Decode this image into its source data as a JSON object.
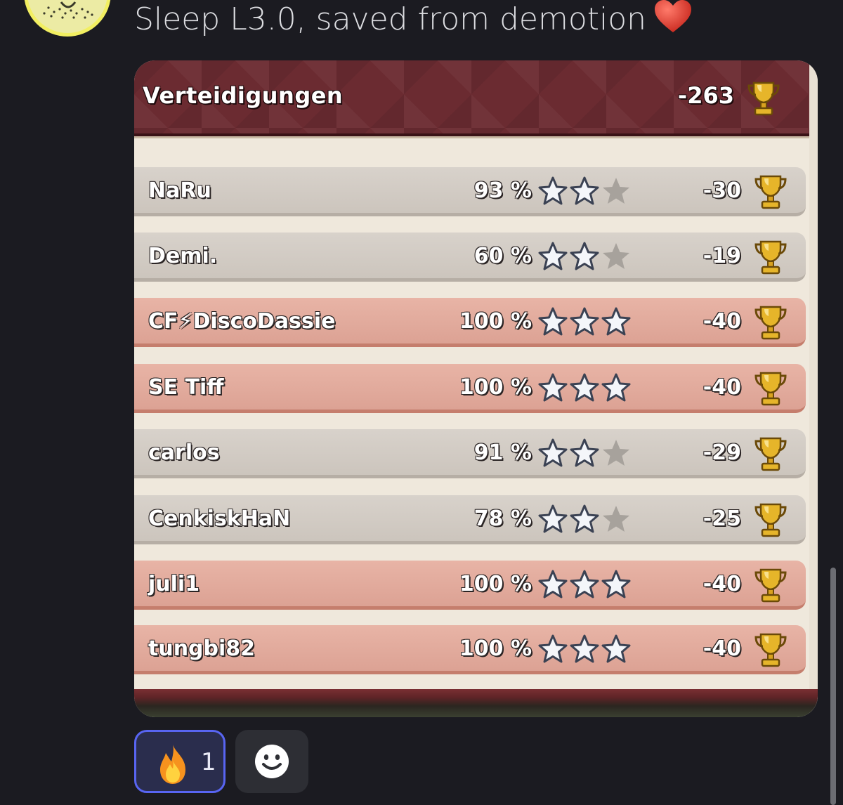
{
  "message": {
    "text": "Sleep L3.0, saved from demotion",
    "emoji": "red-heart"
  },
  "report": {
    "title": "Verteidigungen",
    "total_trophies": "-263",
    "rows": [
      {
        "name": "NaRu",
        "percent": "93 %",
        "stars": 2,
        "trophies": "-30",
        "style": "grey"
      },
      {
        "name": "Demi.",
        "percent": "60 %",
        "stars": 2,
        "trophies": "-19",
        "style": "grey"
      },
      {
        "name": "CF⚡DiscoDassie",
        "percent": "100 %",
        "stars": 3,
        "trophies": "-40",
        "style": "red"
      },
      {
        "name": "SE Tiff",
        "percent": "100 %",
        "stars": 3,
        "trophies": "-40",
        "style": "red"
      },
      {
        "name": "carlos",
        "percent": "91 %",
        "stars": 2,
        "trophies": "-29",
        "style": "grey"
      },
      {
        "name": "CenkiskHaN",
        "percent": "78 %",
        "stars": 2,
        "trophies": "-25",
        "style": "grey"
      },
      {
        "name": "juli1",
        "percent": "100 %",
        "stars": 3,
        "trophies": "-40",
        "style": "red"
      },
      {
        "name": "tungbi82",
        "percent": "100 %",
        "stars": 3,
        "trophies": "-40",
        "style": "red"
      }
    ]
  },
  "reactions": [
    {
      "emoji": "fire-icon",
      "count": "1",
      "selected": true
    }
  ],
  "colors": {
    "background": "#1b1b21",
    "header_maroon": "#6b2b31",
    "row_grey": "#d8d2cb",
    "row_red": "#e8b4a6",
    "reaction_accent": "#5865f2"
  }
}
